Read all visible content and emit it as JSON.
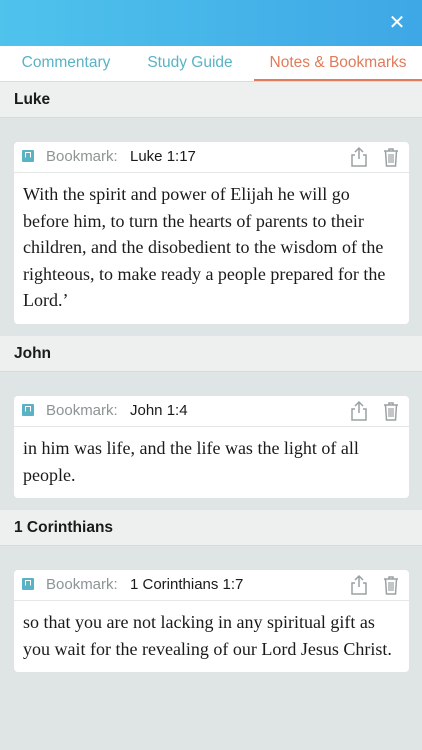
{
  "header": {
    "close_label": "✕"
  },
  "tabs": [
    {
      "label": "Commentary"
    },
    {
      "label": "Study Guide"
    },
    {
      "label": "Notes & Bookmarks"
    }
  ],
  "sections": [
    {
      "title": "Luke",
      "bookmark_type": "Bookmark:",
      "reference": "Luke 1:17",
      "text": "With the spirit and power of Elijah he will go before him, to turn the hearts of parents to their children, and the disobedient to the wisdom of the righteous, to make ready a people prepared for the Lord.’"
    },
    {
      "title": "John",
      "bookmark_type": "Bookmark:",
      "reference": "John 1:4",
      "text": "in him was life, and the life was the light of all people."
    },
    {
      "title": "1 Corinthians",
      "bookmark_type": "Bookmark:",
      "reference": "1 Corinthians 1:7",
      "text": "so that you are not lacking in any spiritual gift as you wait for the revealing of our Lord Jesus Christ."
    }
  ],
  "colors": {
    "header_gradient_start": "#4fc3ec",
    "header_gradient_end": "#3ea7e6",
    "tab_active": "#e07b5b",
    "tab_inactive": "#5ab3c4",
    "bookmark_icon": "#5ab3c4",
    "background": "#dfe5e4"
  },
  "icons": [
    "close-icon",
    "bookmark-icon",
    "share-icon",
    "trash-icon"
  ]
}
